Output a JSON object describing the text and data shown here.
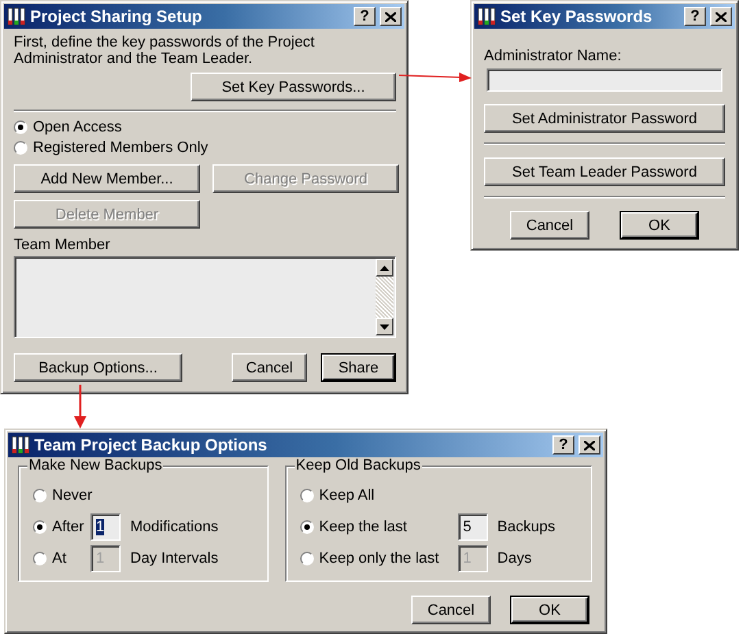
{
  "sharing_window": {
    "title": "Project Sharing Setup",
    "help": "?",
    "intro": "First, define the key passwords of the Project Administrator and the Team Leader.",
    "set_keys_button": {
      "label": "Set Key Passwords..."
    },
    "access_options": [
      {
        "label": "Open Access",
        "selected": true
      },
      {
        "label": "Registered Members Only",
        "selected": false
      }
    ],
    "member_buttons": [
      {
        "label": "Add New Member...",
        "disabled": false
      },
      {
        "label": "Change Password",
        "disabled": true
      },
      {
        "label": "Delete Member",
        "disabled": true
      }
    ],
    "list_label": "Team Member",
    "footer_buttons": [
      {
        "label": "Backup Options...",
        "default": false
      },
      {
        "label": "Cancel",
        "default": false
      },
      {
        "label": "Share",
        "default": true
      }
    ]
  },
  "keys_window": {
    "title": "Set Key Passwords",
    "help": "?",
    "name_label": "Administrator Name:",
    "buttons": [
      "Set Administrator Password",
      "Set Team Leader Password"
    ],
    "footer_buttons": [
      {
        "label": "Cancel",
        "default": false
      },
      {
        "label": "OK",
        "default": true
      }
    ]
  },
  "backup_window": {
    "title": "Team Project Backup Options",
    "help": "?",
    "groups": [
      {
        "title": "Make New Backups",
        "options": [
          {
            "label": "Never",
            "selected": false
          },
          {
            "label": "After",
            "selected": true,
            "value": "1",
            "value_selected": true,
            "field_disabled": false,
            "unit": "Modifications"
          },
          {
            "label": "At",
            "selected": false,
            "value": "1",
            "value_selected": false,
            "field_disabled": true,
            "unit": "Day Intervals"
          }
        ]
      },
      {
        "title": "Keep Old Backups",
        "options": [
          {
            "label": "Keep All",
            "selected": false
          },
          {
            "label": "Keep the last",
            "selected": true,
            "value": "5",
            "value_selected": false,
            "field_disabled": false,
            "unit": "Backups"
          },
          {
            "label": "Keep only the last",
            "selected": false,
            "value": "1",
            "value_selected": false,
            "field_disabled": true,
            "unit": "Days"
          }
        ]
      }
    ],
    "footer_buttons": [
      {
        "label": "Cancel",
        "default": false
      },
      {
        "label": "OK",
        "default": true
      }
    ]
  }
}
